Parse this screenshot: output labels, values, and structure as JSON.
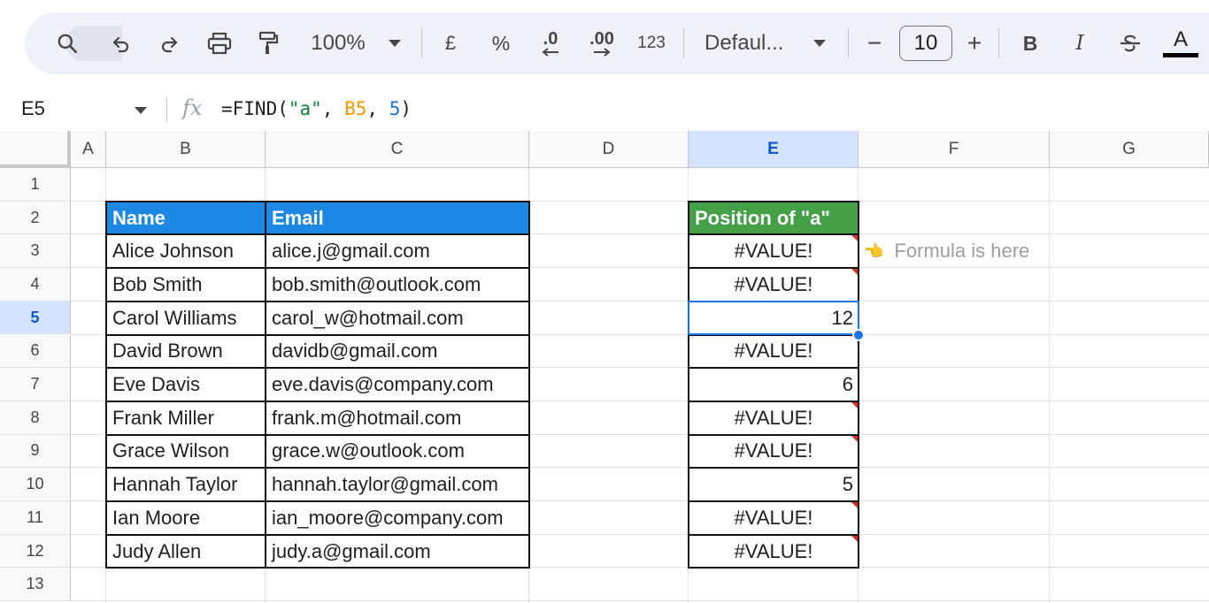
{
  "toolbar": {
    "zoom": "100%",
    "currency": "£",
    "percent": "%",
    "decrease_decimal": ".0",
    "increase_decimal": ".00",
    "number_format": "123",
    "font": "Defaul...",
    "font_size": "10",
    "bold": "B",
    "italic": "I",
    "text_color": "A",
    "minus": "−",
    "plus": "+"
  },
  "formula_bar": {
    "name_box": "E5",
    "fx": "fx",
    "formula_prefix": "=FIND(",
    "formula_str": "\"a\"",
    "formula_sep1": ", ",
    "formula_ref": "B5",
    "formula_sep2": ", ",
    "formula_num": "5",
    "formula_suffix": ")"
  },
  "columns": [
    "A",
    "B",
    "C",
    "D",
    "E",
    "F",
    "G"
  ],
  "rows": [
    "1",
    "2",
    "3",
    "4",
    "5",
    "6",
    "7",
    "8",
    "9",
    "10",
    "11",
    "12",
    "13"
  ],
  "selected_cell": {
    "column": "E",
    "row": "5"
  },
  "table": {
    "header_name": "Name",
    "header_email": "Email",
    "header_position": "Position of \"a\"",
    "header_colors": {
      "name_email": "#1e88e5",
      "position": "#43a047"
    },
    "entries": [
      {
        "name": "Alice Johnson",
        "email": "alice.j@gmail.com",
        "position": "#VALUE!"
      },
      {
        "name": "Bob Smith",
        "email": "bob.smith@outlook.com",
        "position": "#VALUE!"
      },
      {
        "name": "Carol Williams",
        "email": "carol_w@hotmail.com",
        "position": "12"
      },
      {
        "name": "David Brown",
        "email": "davidb@gmail.com",
        "position": "#VALUE!"
      },
      {
        "name": "Eve Davis",
        "email": "eve.davis@company.com",
        "position": "6"
      },
      {
        "name": "Frank Miller",
        "email": "frank.m@hotmail.com",
        "position": "#VALUE!"
      },
      {
        "name": "Grace Wilson",
        "email": "grace.w@outlook.com",
        "position": "#VALUE!"
      },
      {
        "name": "Hannah Taylor",
        "email": "hannah.taylor@gmail.com",
        "position": "5"
      },
      {
        "name": "Ian Moore",
        "email": "ian_moore@company.com",
        "position": "#VALUE!"
      },
      {
        "name": "Judy Allen",
        "email": "judy.a@gmail.com",
        "position": "#VALUE!"
      }
    ]
  },
  "note": {
    "emoji": "👈",
    "text": "Formula is here"
  }
}
